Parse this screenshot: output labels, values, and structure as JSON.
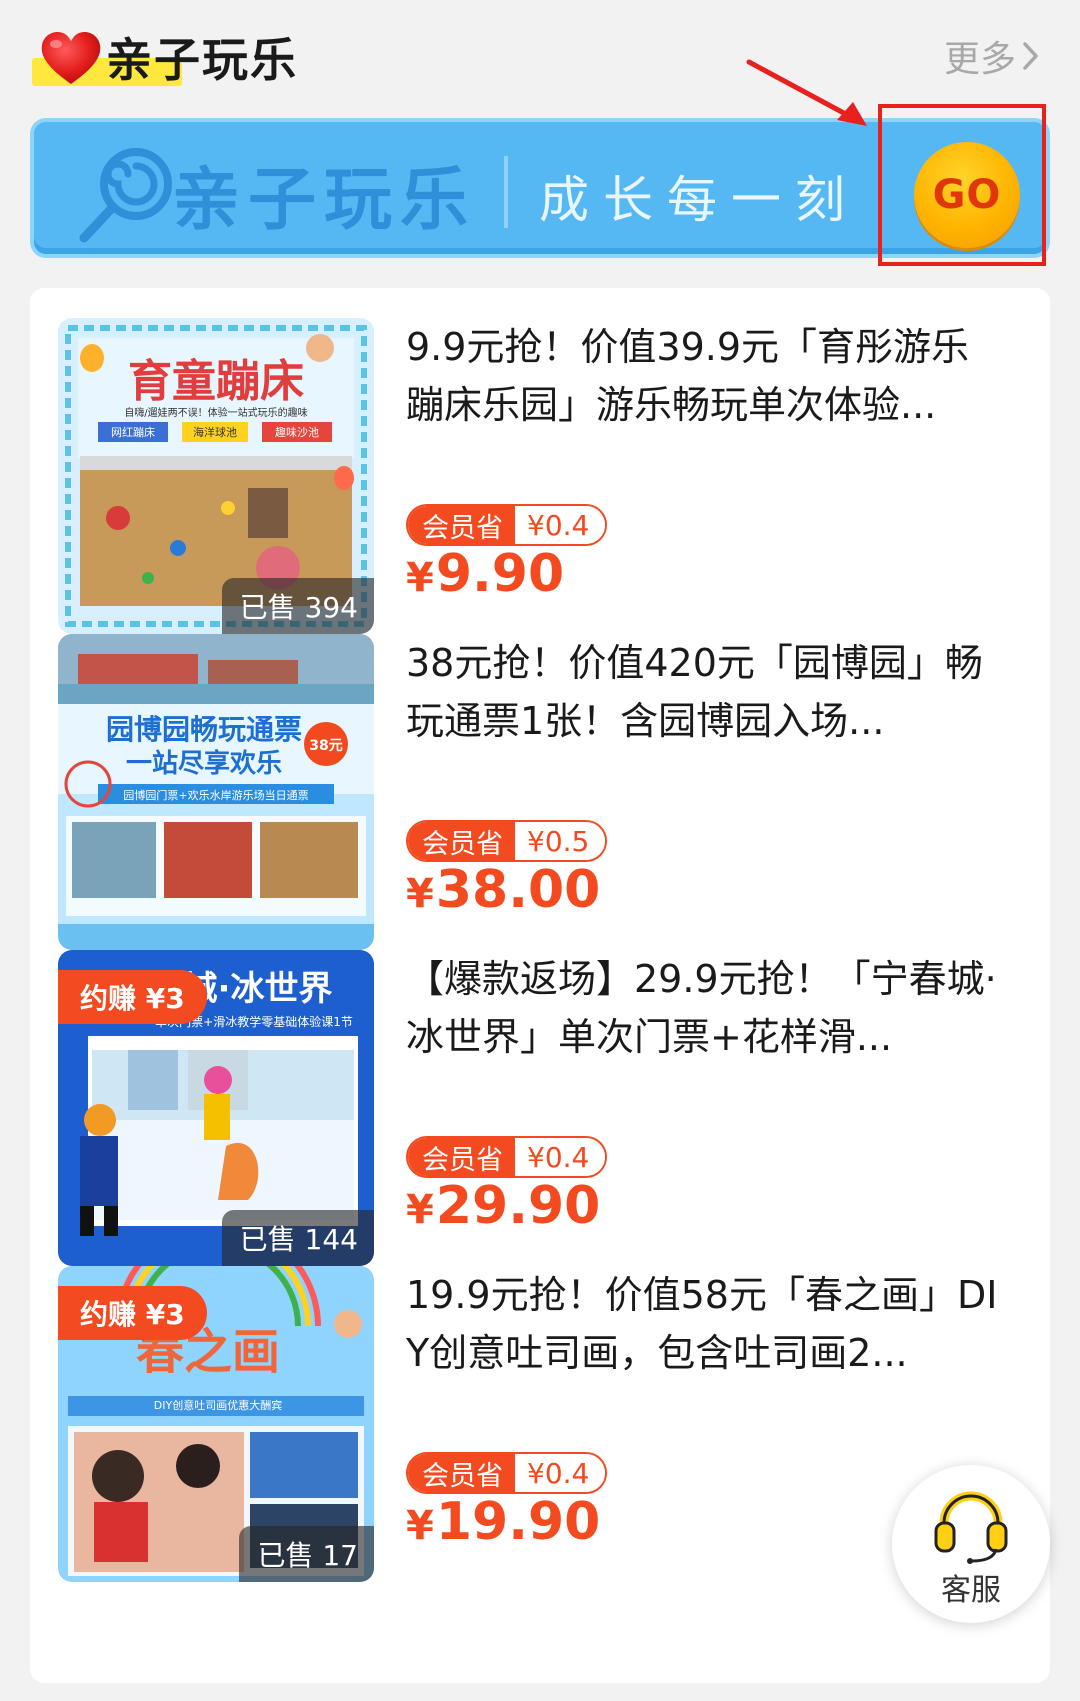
{
  "section": {
    "title": "亲子玩乐",
    "more_label": "更多"
  },
  "banner": {
    "title": "亲子玩乐",
    "subtitle": "成长每一刻",
    "go_label": "GO"
  },
  "products": [
    {
      "desc": "9.9元抢！价值39.9元「育彤游乐蹦床乐园」游乐畅玩单次体验...",
      "member_label": "会员省",
      "member_save": "¥0.4",
      "price_symbol": "¥",
      "price": "9.90",
      "sold": "已售 394",
      "earn": "",
      "thumb_text": "育童蹦床",
      "thumb_sub": "自嗨/遛娃两不误！体验一站式玩乐的趣味",
      "thumb_tags": [
        "网红蹦床",
        "海洋球池",
        "趣味沙池"
      ]
    },
    {
      "desc": "38元抢！价值420元「园博园」畅玩通票1张！含园博园入场...",
      "member_label": "会员省",
      "member_save": "¥0.5",
      "price_symbol": "¥",
      "price": "38.00",
      "sold": "",
      "earn": "",
      "thumb_text": "园博园畅玩通票",
      "thumb_text2": "一站尽享欢乐",
      "thumb_badge": "38元",
      "thumb_sub": "园博园门票+欢乐水岸游乐场当日通票"
    },
    {
      "desc": "【爆款返场】29.9元抢！「宁春城·冰世界」单次门票+花样滑...",
      "member_label": "会员省",
      "member_save": "¥0.4",
      "price_symbol": "¥",
      "price": "29.90",
      "sold": "已售 144",
      "earn": "约赚 ¥3",
      "thumb_text": "城·冰世界",
      "thumb_sub": "单次门票+滑冰教学零基础体验课1节"
    },
    {
      "desc": "19.9元抢！价值58元「春之画」DIY创意吐司画，包含吐司画2...",
      "member_label": "会员省",
      "member_save": "¥0.4",
      "price_symbol": "¥",
      "price": "19.90",
      "sold": "已售 17",
      "earn": "约赚 ¥3",
      "thumb_text": "春之画",
      "thumb_sub": "DIY创意吐司画优惠大酬宾"
    }
  ],
  "service": {
    "label": "客服"
  },
  "colors": {
    "accent": "#f44a1f",
    "banner_bg": "#56b8f3",
    "go_button": "#ffb400",
    "annotation": "#e8201e"
  },
  "icons": [
    "heart-icon",
    "chevron-right-icon",
    "lollipop-icon",
    "headset-icon"
  ]
}
